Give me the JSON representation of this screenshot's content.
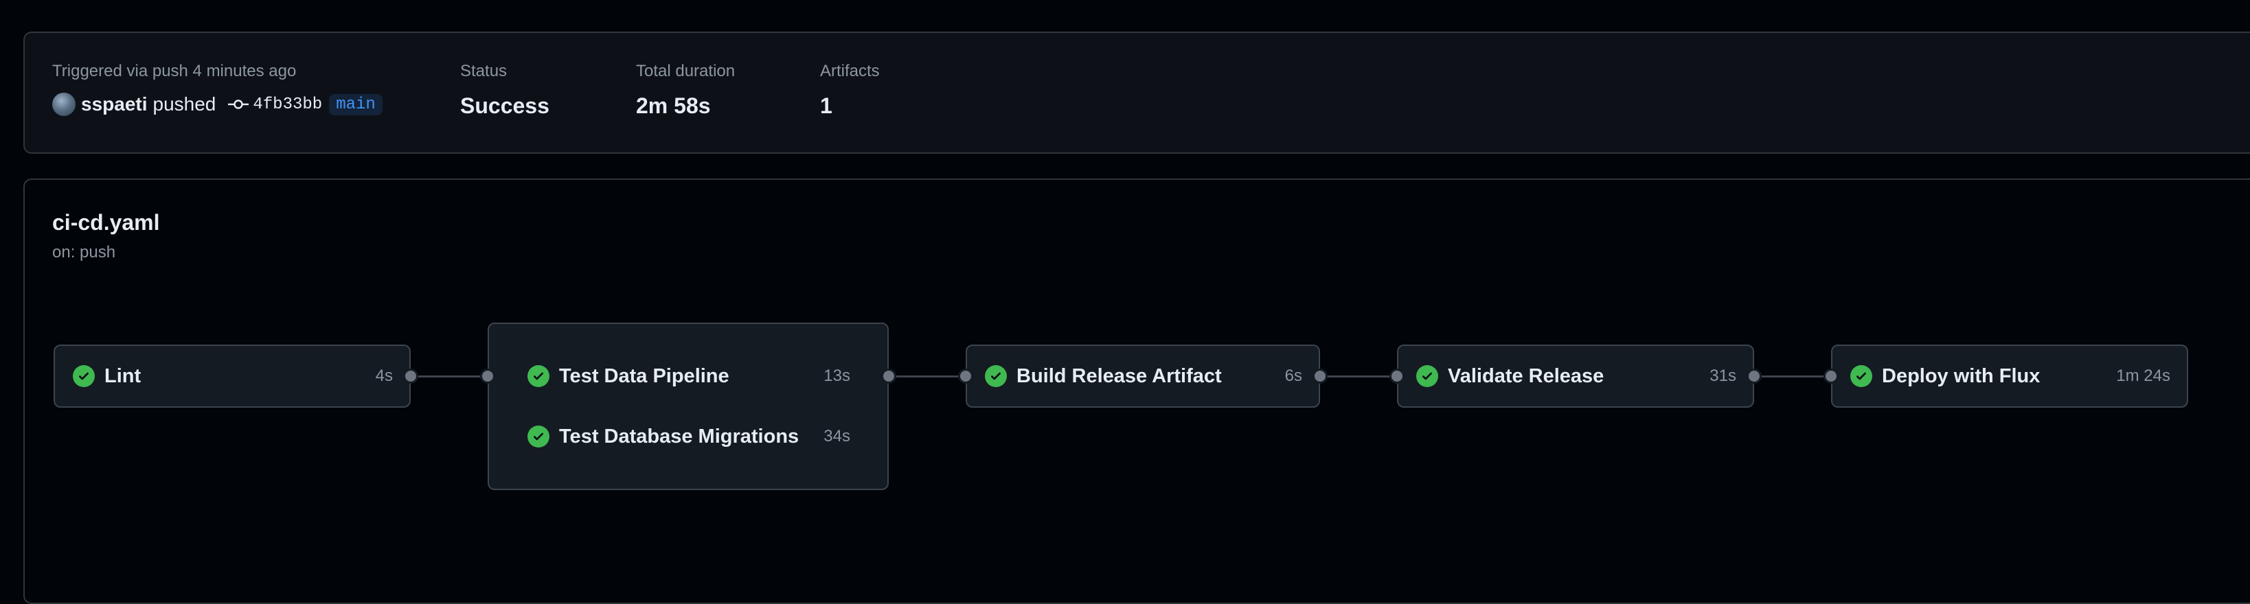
{
  "summary": {
    "trigger_label": "Triggered via push 4 minutes ago",
    "actor": "sspaeti",
    "action": "pushed",
    "commit_sha": "4fb33bb",
    "branch": "main",
    "status_label": "Status",
    "status_value": "Success",
    "duration_label": "Total duration",
    "duration_value": "2m 58s",
    "artifacts_label": "Artifacts",
    "artifacts_value": "1"
  },
  "workflow": {
    "file": "ci-cd.yaml",
    "trigger": "on: push"
  },
  "jobs": {
    "lint": {
      "name": "Lint",
      "duration": "4s",
      "status": "success"
    },
    "test_data_pipeline": {
      "name": "Test Data Pipeline",
      "duration": "13s",
      "status": "success"
    },
    "test_db_migrations": {
      "name": "Test Database Migrations",
      "duration": "34s",
      "status": "success"
    },
    "build": {
      "name": "Build Release Artifact",
      "duration": "6s",
      "status": "success"
    },
    "validate": {
      "name": "Validate Release",
      "duration": "31s",
      "status": "success"
    },
    "deploy": {
      "name": "Deploy with Flux",
      "duration": "1m 24s",
      "status": "success"
    }
  },
  "colors": {
    "success": "#3fb950",
    "branch": "#4493f8",
    "panel_bg": "#0d1117",
    "card_bg": "#151b23",
    "border": "#3d444d"
  }
}
